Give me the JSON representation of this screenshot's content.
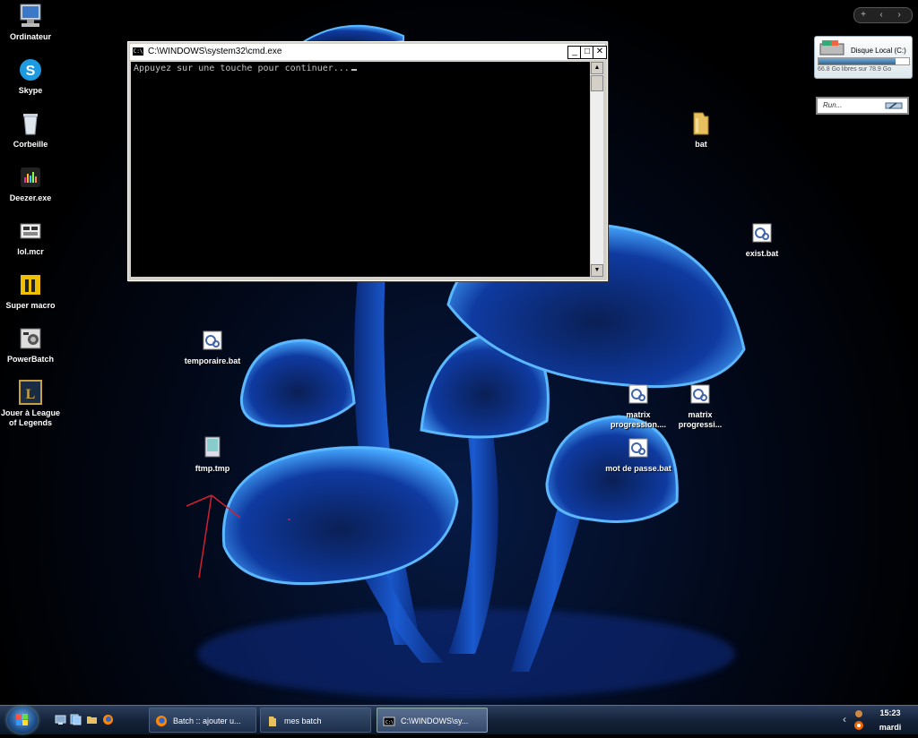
{
  "desktop": {
    "left_icons": [
      {
        "label": "Ordinateur",
        "icon": "computer-icon"
      },
      {
        "label": "Skype",
        "icon": "skype-icon"
      },
      {
        "label": "Corbeille",
        "icon": "recycle-bin-icon"
      },
      {
        "label": "Deezer.exe",
        "icon": "deezer-icon"
      },
      {
        "label": "lol.mcr",
        "icon": "macro-file-icon"
      },
      {
        "label": "Super macro",
        "icon": "super-macro-icon"
      },
      {
        "label": "PowerBatch",
        "icon": "powerbatch-icon"
      },
      {
        "label": "Jouer à League\nof Legends",
        "icon": "league-of-legends-icon"
      }
    ],
    "files": {
      "temporaire": "temporaire.bat",
      "ftmp": "ftmp.tmp",
      "bat_folder": "bat",
      "exist": "exist.bat",
      "matrix1": "matrix progression....",
      "matrix2": "matrix progressi...",
      "motdepasse": "mot de passe.bat"
    }
  },
  "cmd_window": {
    "title": "C:\\WINDOWS\\system32\\cmd.exe",
    "icon_text": "C:\\",
    "output": "Appuyez sur une touche pour continuer..."
  },
  "gadgets": {
    "control": {
      "add": "+",
      "prev": "‹",
      "next": "›"
    },
    "disk": {
      "name": "Disque Local (C:)",
      "info": "66.8 Go libres sur 78.9 Go",
      "free_fraction": 0.85
    },
    "run": {
      "placeholder": "Run..."
    }
  },
  "taskbar": {
    "tasks": [
      {
        "label": "Batch :: ajouter u...",
        "icon": "firefox-icon"
      },
      {
        "label": "mes batch",
        "icon": "folder-icon"
      },
      {
        "label": "C:\\WINDOWS\\sy...",
        "icon": "cmd-icon"
      }
    ],
    "tray_arrow": "‹",
    "clock_time": "15:23",
    "clock_day": "mardi"
  }
}
